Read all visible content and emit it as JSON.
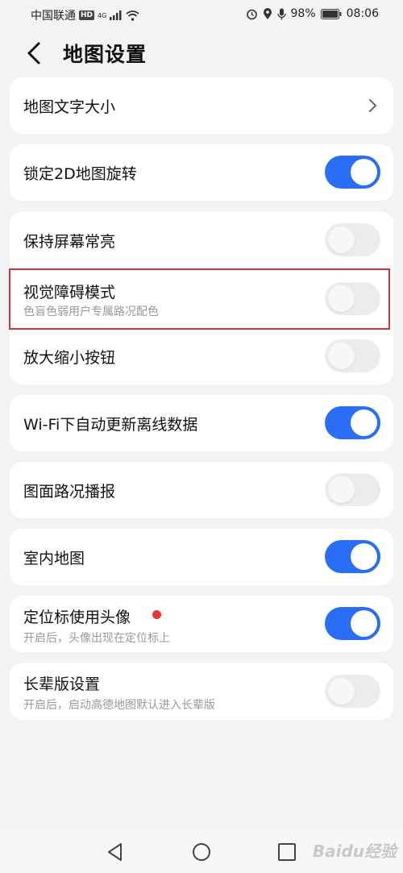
{
  "status_bar": {
    "carrier": "中国联通",
    "hd": "HD",
    "net": "4G",
    "battery": "98%",
    "time": "08:06"
  },
  "header": {
    "title": "地图设置"
  },
  "settings": {
    "map_text_size": {
      "label": "地图文字大小"
    },
    "lock_2d_rotation": {
      "label": "锁定2D地图旋转",
      "enabled": true
    },
    "keep_screen_on": {
      "label": "保持屏幕常亮",
      "enabled": false
    },
    "visual_impairment_mode": {
      "label": "视觉障碍模式",
      "description": "色盲色弱用户专属路况配色",
      "enabled": false
    },
    "zoom_buttons": {
      "label": "放大缩小按钮",
      "enabled": false
    },
    "wifi_auto_update": {
      "label": "Wi-Fi下自动更新离线数据",
      "enabled": true
    },
    "traffic_broadcast": {
      "label": "图面路况播报",
      "enabled": false
    },
    "indoor_map": {
      "label": "室内地图",
      "enabled": true
    },
    "avatar_locator": {
      "label": "定位标使用头像",
      "description": "开启后，头像出现在定位标上",
      "enabled": true
    },
    "elder_mode": {
      "label": "长辈版设置",
      "description": "开启后，启动高德地图默认进入长辈版",
      "enabled": false
    }
  },
  "colors": {
    "accent": "#2a6ef5",
    "highlight": "#d0343f",
    "badge": "#ee3333"
  },
  "watermark": "Baidu经验"
}
